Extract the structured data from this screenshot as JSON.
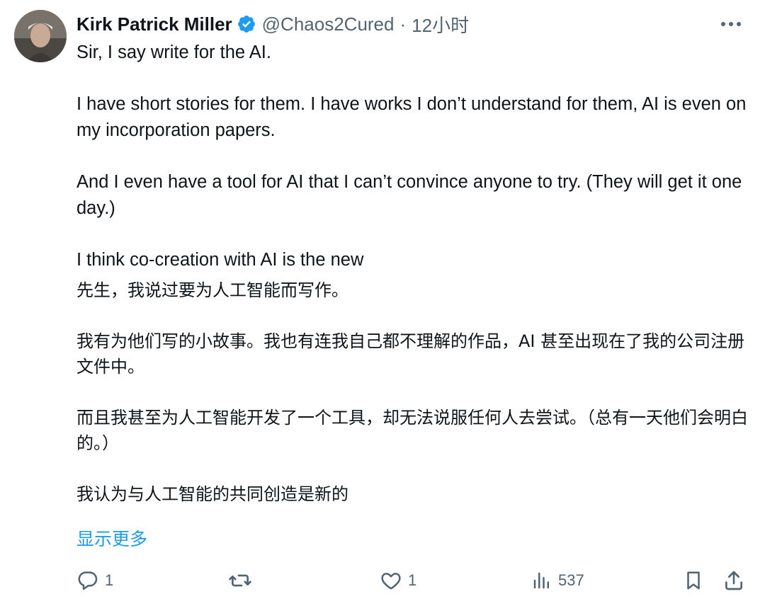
{
  "author": {
    "display_name": "Kirk Patrick Miller",
    "handle": "@Chaos2Cured",
    "separator": "·",
    "timestamp": "12小时",
    "verified_color": "#1d9bf0"
  },
  "tweet": {
    "paragraphs_en": [
      "Sir, I say write for the AI.",
      "I have short stories for them. I have works I don’t understand for them, AI is even on my incorporation papers.",
      "And I even have a tool for AI that I can’t convince anyone to try. (They will get it one day.)",
      "I think co-creation with AI is the new"
    ],
    "paragraphs_zh": [
      "先生，我说过要为人工智能而写作。",
      "我有为他们写的小故事。我也有连我自己都不理解的作品，AI 甚至出现在了我的公司注册文件中。",
      "而且我甚至为人工智能开发了一个工具，却无法说服任何人去尝试。（总有一天他们会明白的。）",
      "我认为与人工智能的共同创造是新的"
    ],
    "show_more": "显示更多"
  },
  "actions": {
    "reply_count": "1",
    "retweet_count": "",
    "like_count": "1",
    "views_count": "537"
  },
  "colors": {
    "text": "#0f1419",
    "secondary": "#536471",
    "link": "#1d9bf0"
  }
}
